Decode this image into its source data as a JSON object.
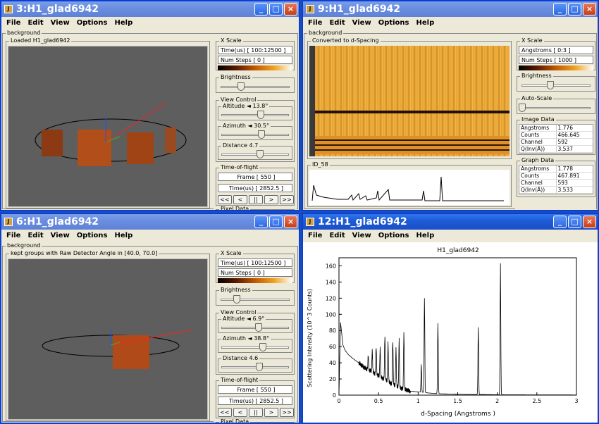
{
  "w1": {
    "title": "3:H1_glad6942",
    "menu": [
      "File",
      "Edit",
      "View",
      "Options",
      "Help"
    ],
    "bg": "background",
    "view_label": "Loaded H1_glad6942",
    "xscale": "X Scale",
    "time_range": "Time(us) [ 100:12500 ]",
    "num_steps": "Num Steps [ 0 ]",
    "brightness": "Brightness",
    "view_control": "View Control",
    "altitude": "Altitude ◄ 13.8°",
    "azimuth": "Azimuth ◄ 30.5°",
    "distance": "Distance 4.7",
    "tof": "Time-of-flight",
    "frame": "Frame  [ 550 ]",
    "time": "Time(us) [ 2852.5 ]",
    "nav": [
      "<<",
      "<",
      "||",
      ">",
      ">>"
    ],
    "pixel": "Pixel Data"
  },
  "w2": {
    "title": "9:H1_glad6942",
    "menu": [
      "File",
      "Edit",
      "View",
      "Options",
      "Help"
    ],
    "bg": "background",
    "image_label": "Converted to d-Spacing",
    "graph_label": "ID_58",
    "xscale": "X Scale",
    "angstroms": "Angstroms [ 0:3 ]",
    "num_steps": "Num Steps [ 1000 ]",
    "brightness": "Brightness",
    "autoscale": "Auto-Scale",
    "image_data": "Image Data",
    "image_rows": [
      [
        "Angstroms",
        "1.776"
      ],
      [
        "Counts",
        "466.645"
      ],
      [
        "Channel",
        "592"
      ],
      [
        "Q(Inv(Å))",
        "3.537"
      ]
    ],
    "graph_data": "Graph Data",
    "graph_rows": [
      [
        "Angstroms",
        "1.778"
      ],
      [
        "Counts",
        "467.891"
      ],
      [
        "Channel",
        "593"
      ],
      [
        "Q(Inv(Å))",
        "3.533"
      ]
    ]
  },
  "w3": {
    "title": "6:H1_glad6942",
    "menu": [
      "File",
      "Edit",
      "View",
      "Options",
      "Help"
    ],
    "bg": "background",
    "view_label": "kept groups with Raw Detector Angle in [40.0, 70.0]",
    "xscale": "X Scale",
    "time_range": "Time(us) [ 100:12500 ]",
    "num_steps": "Num Steps [ 0 ]",
    "brightness": "Brightness",
    "view_control": "View Control",
    "altitude": "Altitude ◄ 6.9°",
    "azimuth": "Azimuth ◄ 38.8°",
    "distance": "Distance 4.6",
    "tof": "Time-of-flight",
    "frame": "Frame  [ 550 ]",
    "time": "Time(us) [ 2852.5 ]",
    "nav": [
      "<<",
      "<",
      "||",
      ">",
      ">>"
    ],
    "pixel": "Pixel Data"
  },
  "w4": {
    "title": "12:H1_glad6942",
    "menu": [
      "File",
      "Edit",
      "View",
      "Options",
      "Help"
    ]
  },
  "chart_data": {
    "type": "line",
    "title": "H1_glad6942",
    "xlabel": "d-Spacing  (Angstroms )",
    "ylabel": "Scattering Intensity  (10^3 Counts)",
    "xlim": [
      0,
      3
    ],
    "ylim": [
      0,
      170
    ],
    "xticks": [
      "0",
      "0.5",
      "1",
      "1.5",
      "2",
      "2.5",
      "3"
    ],
    "yticks": [
      "0",
      "20",
      "40",
      "60",
      "80",
      "100",
      "120",
      "140",
      "160"
    ],
    "background": [
      [
        0.0,
        0
      ],
      [
        0.02,
        90
      ],
      [
        0.05,
        62
      ],
      [
        0.08,
        55
      ],
      [
        0.12,
        50
      ],
      [
        0.18,
        45
      ],
      [
        0.25,
        40
      ],
      [
        0.32,
        34
      ],
      [
        0.4,
        30
      ],
      [
        0.5,
        24
      ],
      [
        0.6,
        18
      ],
      [
        0.7,
        12
      ],
      [
        0.8,
        8
      ],
      [
        0.9,
        5
      ],
      [
        1.0,
        4
      ],
      [
        1.2,
        2
      ],
      [
        1.5,
        1
      ],
      [
        2.0,
        0.5
      ],
      [
        3.0,
        0.2
      ]
    ],
    "peaks": [
      {
        "x": 0.37,
        "y": 50
      },
      {
        "x": 0.42,
        "y": 55
      },
      {
        "x": 0.47,
        "y": 60
      },
      {
        "x": 0.52,
        "y": 58
      },
      {
        "x": 0.58,
        "y": 75
      },
      {
        "x": 0.62,
        "y": 65
      },
      {
        "x": 0.68,
        "y": 68
      },
      {
        "x": 0.72,
        "y": 58
      },
      {
        "x": 0.76,
        "y": 70
      },
      {
        "x": 0.82,
        "y": 77
      },
      {
        "x": 1.04,
        "y": 38
      },
      {
        "x": 1.08,
        "y": 120
      },
      {
        "x": 1.25,
        "y": 89
      },
      {
        "x": 1.76,
        "y": 84
      },
      {
        "x": 2.04,
        "y": 163
      }
    ]
  }
}
